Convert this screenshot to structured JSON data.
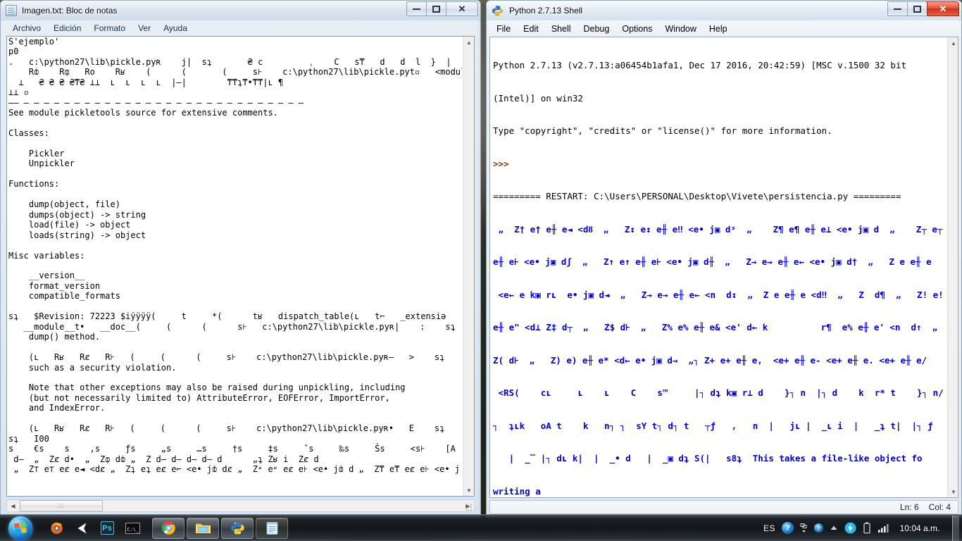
{
  "notepad": {
    "title": "Imagen.txt: Bloc de notas",
    "icon": "notepad-icon",
    "menu": [
      "Archivo",
      "Edición",
      "Formato",
      "Ver",
      "Ayuda"
    ],
    "window_buttons": {
      "minimize": "–",
      "maximize": "❐",
      "close": "✕"
    },
    "content": "S'ejemplo'\np0\n.   c:\\python27\\lib\\pickle.pyʀ    j|  sʇ       ₴ c         ˌ    C   s₸   d   d  l  }  |\n    Rȸ    Rȹ   Ro    Rʁ    (      (       (     s⊦    c:\\python27\\lib\\pickle.pyt▫   <module>⊦\n  ⊥   ₴ ₴ ₴ ₴₸₴ ⊥⊥  ʟ  ʟ  ʟ  ʟ  |–|        ₸₸ʇ₸•₸₸|ʟ ¶\n⊥⊥ ▫\n–– – – – – – – – – – – – – – – – – – – – – – – – – – – – –\nSee module pickletools source for extensive comments.\n\nClasses:\n\n    Pickler\n    Unpickler\n\nFunctions:\n\n    dump(object, file)\n    dumps(object) -> string\n    load(file) -> object\n    loads(string) -> object\n\nMisc variables:\n\n    __version__\n    format_version\n    compatible_formats\n\nsʇ   $Revision: 72223 $iÿÿÿÿ(     t     *(      tʁ   dispatch_table(ʟ   t⌐   _extensiǝ\n   __module__t•   __doc__(     (      (      s⊦   c:\\python27\\lib\\pickle.pyʀ|    :    sʇ\n    dump() method.\n\n    (ʟ   Rʁ   Rȼ   R⊦   (     (      (     s⊦    c:\\python27\\lib\\pickle.pyʀ–   >    sʇ     ˌ\n    such as a security violation.\n\n    Note that other exceptions may also be raised during unpickling, including\n    (but not necessarily limited to) AttributeError, EOFError, ImportError,\n    and IndexError.\n\n    (ʟ   Rʁ   Rȼ   R⊦   (     (      (     s⊦    c:\\python27\\lib\\pickle.pyʀ•   E    sʇ     ˌ\nsʇ   I00\ns    €s    s    ,s     ƒs     „s     …s     †s     ‡s     ˆs     ‰s     Šs     <s⊦    [A\n d–  „  Zȼ d•  „  Zȹ dȸ „  Z d– d– d– d– d      „ʇ Zʁ i  Zȼ d\n „  Z⊤ e⊤ eȼ e◄ <dȼ „  Zʇ eʇ eȼ e⌐ <e• jȸ dȼ „  Zʶ eʶ eȼ e⊦ <e• jȸ d „  Z₸ e₸ eȼ e⊦ <e• j",
    "hscroll": {
      "left_arrow": "◀",
      "right_arrow": "▶",
      "thumb": "⦙⦙⦙"
    },
    "vscroll": {
      "up_arrow": "▲",
      "down_arrow": "▼"
    }
  },
  "pyshell": {
    "title": "Python 2.7.13 Shell",
    "icon": "python-icon",
    "menu": [
      "File",
      "Edit",
      "Shell",
      "Debug",
      "Options",
      "Window",
      "Help"
    ],
    "window_buttons": {
      "minimize": "–",
      "maximize": "❐",
      "close": "✕"
    },
    "banner": [
      "Python 2.7.13 (v2.7.13:a06454b1afa1, Dec 17 2016, 20:42:59) [MSC v.1500 32 bit",
      "(Intel)] on win32",
      "Type \"copyright\", \"credits\" or \"license()\" for more information."
    ],
    "prompt": ">>>",
    "restart_line": "========= RESTART: C:\\Users\\PERSONAL\\Desktop\\Vivete\\persistencia.py =========",
    "binary_output": [
      " „  Z† e† e╫ e◄ <dȣ  „   Z↕ e↕ e╫ e‼ <e• j▣ dᶟ  „    Z¶ e¶ e╫ e⊥ <e• j▣ d  „    Z┬ e┬",
      "e╫ e⊦ <e• j▣ dʃ  „   Z↑ e↑ e╫ e⊦ <e• j▣ d╫  „   Z→ e→ e╫ e← <e• j▣ d†  „   Z e e╫ e",
      " <e← e k▣ rʟ  e• j▣ d◄  „   Z→ e→ e╫ e← <n  d↕  „  Z e e╫ e <d‼  „   Z  d¶  „   Z! e!",
      "e╫ e\" <d⊥ Z‡ d┬  „   Z$ d⊦  „   Z% e% e╫ e& <e' d← k          r¶  e% e╫ e' <n  d↑  „",
      "Z( d⊦  „   Z) e) e╫ e* <d← e• j▣ d→  „┐ Z+ e+ e╫ e,  <e+ e╫ e- <e+ e╫ e. <e+ e╫ e/",
      " <RS(    cʟ     ʟ    ʟ    C    s™     |┐ dʇ k▣ r⊥ d    }┐ n  |┐ d    k  r* t    }┐ n/ d    |",
      "┐  ʇʟk   oA t    k   n┐ ┐  sY t┐ d┐ t   ┬ƒ   ,   n  |   jʟ |  _ʟ i  |   _ʇ t|  |┐ ƒ",
      "   |  _‾ |┐ dʟ k|  |  _• d   |  _▣ dʇ S(|   s8ʇ  This takes a file-like object fo",
      "writing a"
    ],
    "status": {
      "line": "Ln: 6",
      "column": "Col: 4"
    },
    "vscroll": {
      "up_arrow": "▲",
      "down_arrow": "▼"
    }
  },
  "taskbar": {
    "start_label": "start-orb",
    "quicklaunch": [
      {
        "name": "firefox-icon",
        "label": "Firefox"
      },
      {
        "name": "unity-icon",
        "label": "Unity"
      },
      {
        "name": "photoshop-icon",
        "label": "Ps"
      },
      {
        "name": "command-prompt-icon",
        "label": "C:\\_"
      }
    ],
    "task_buttons": [
      {
        "name": "taskbar-chrome",
        "label": "Google Chrome"
      },
      {
        "name": "taskbar-explorer",
        "label": "Explorador de Windows"
      },
      {
        "name": "taskbar-python",
        "label": "Python 2.7.13 Shell"
      },
      {
        "name": "taskbar-notepad",
        "label": "Imagen.txt: Bloc de notas"
      }
    ],
    "tray": {
      "language": "ES",
      "help_icon": "?",
      "action_center_icon": "?",
      "show_hidden_icon": "▲",
      "flash_icon": "⚡",
      "battery_icon": "battery",
      "network_icon": "signal",
      "clock": "10:04 a.m."
    }
  },
  "colors": {
    "shell_blue": "#0000cc",
    "shell_prompt": "#8b2f00",
    "close_active": "#c9301a",
    "taskbar": "#12151a"
  }
}
